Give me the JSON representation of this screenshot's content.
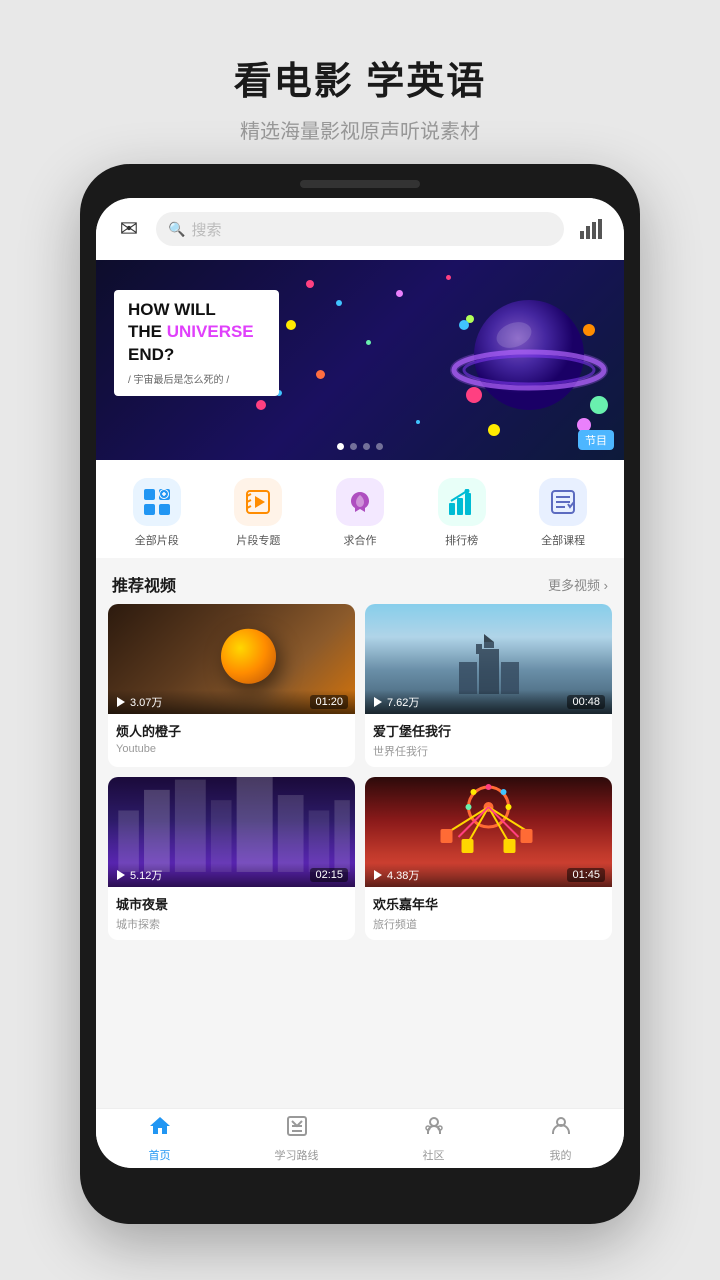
{
  "header": {
    "title": "看电影 学英语",
    "subtitle": "精选海量影视原声听说素材"
  },
  "topbar": {
    "search_placeholder": "搜索"
  },
  "banner": {
    "line1": "HOW WILL",
    "line2_prefix": "THE ",
    "line2_highlight": "UNIVERSE",
    "line2_suffix": "",
    "line3": "END?",
    "subtitle": "/ 宇宙最后是怎么死的 /",
    "tag": "节目",
    "dots": [
      "active",
      "",
      "",
      ""
    ]
  },
  "categories": [
    {
      "label": "全部片段",
      "icon": "⊞"
    },
    {
      "label": "片段专题",
      "icon": "🎬"
    },
    {
      "label": "求合作",
      "icon": "💜"
    },
    {
      "label": "排行榜",
      "icon": "📈"
    },
    {
      "label": "全部课程",
      "icon": "📋"
    }
  ],
  "recommended": {
    "title": "推荐视频",
    "more": "更多视频 ›",
    "videos": [
      {
        "title": "烦人的橙子",
        "channel": "Youtube",
        "views": "3.07万",
        "duration": "01:20",
        "thumb_type": "orange"
      },
      {
        "title": "爱丁堡任我行",
        "channel": "世界任我行",
        "views": "7.62万",
        "duration": "00:48",
        "thumb_type": "castle"
      },
      {
        "title": "城市夜景",
        "channel": "城市探索",
        "views": "5.12万",
        "duration": "02:15",
        "thumb_type": "city"
      },
      {
        "title": "欢乐嘉年华",
        "channel": "旅行频道",
        "views": "4.38万",
        "duration": "01:45",
        "thumb_type": "carnival"
      }
    ]
  },
  "bottomnav": [
    {
      "label": "首页",
      "active": true
    },
    {
      "label": "学习路线",
      "active": false
    },
    {
      "label": "社区",
      "active": false
    },
    {
      "label": "我的",
      "active": false
    }
  ]
}
